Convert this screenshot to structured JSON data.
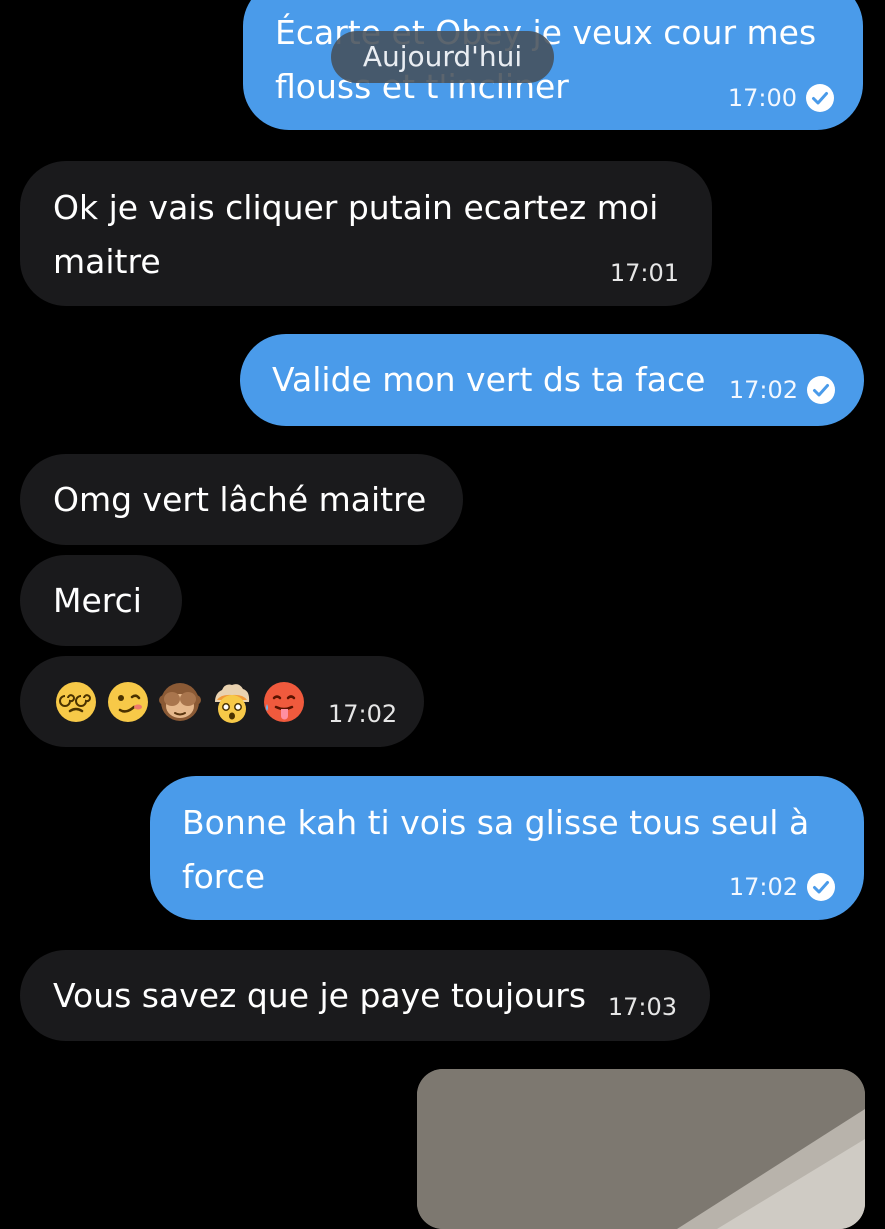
{
  "date_separator": "Aujourd'hui",
  "messages": [
    {
      "direction": "outgoing",
      "lines": [
        "Écarte et Obey je veux cour mes",
        "flouss et t'incliner"
      ],
      "time": "17:00",
      "read": true
    },
    {
      "direction": "incoming",
      "lines": [
        "Ok je vais cliquer putain ecartez moi",
        "maitre"
      ],
      "time": "17:01"
    },
    {
      "direction": "outgoing",
      "lines": [
        "Valide mon vert ds ta face"
      ],
      "time": "17:02",
      "read": true
    },
    {
      "direction": "incoming",
      "lines": [
        "Omg vert lâché maitre"
      ]
    },
    {
      "direction": "incoming",
      "lines": [
        "Merci"
      ]
    },
    {
      "direction": "incoming",
      "emojis": [
        "face-with-spiral-eyes",
        "woozy-face",
        "see-no-evil-monkey",
        "exploding-head",
        "hot-face"
      ],
      "time": "17:02"
    },
    {
      "direction": "outgoing",
      "lines": [
        "Bonne kah ti vois sa glisse tous seul à",
        "force"
      ],
      "time": "17:02",
      "read": true
    },
    {
      "direction": "incoming",
      "lines": [
        "Vous savez que je paye toujours"
      ],
      "time": "17:03"
    },
    {
      "direction": "outgoing",
      "attachment": "photo"
    }
  ],
  "colors": {
    "background": "#000000",
    "incoming_bubble": "#1a1a1c",
    "outgoing_bubble": "#4a9bea",
    "date_pill": "#464f59"
  }
}
